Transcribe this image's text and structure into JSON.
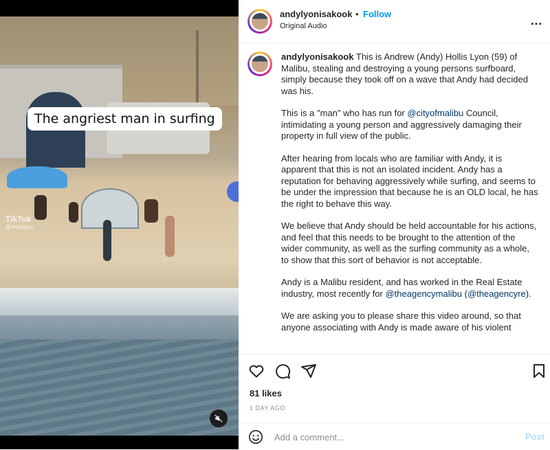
{
  "video": {
    "caption_overlay": "The angriest man in surfing",
    "watermark": "TikTok",
    "watermark_handle": "@andylyon"
  },
  "header": {
    "username": "andylyonisakook",
    "separator": "•",
    "follow_label": "Follow",
    "audio": "Original Audio",
    "more_icon": "…"
  },
  "post": {
    "username": "andylyonisakook",
    "paragraphs": [
      "This is Andrew (Andy) Hollis Lyon (59) of Malibu, stealing and destroying a young persons surfboard, simply because they took off on a wave that Andy had decided was his.",
      "This is a \"man\" who has run for ",
      "After hearing from locals who are familiar with Andy, it is apparent that this is not an isolated incident. Andy has a reputation for behaving aggressively while surfing, and seems to be under the impression that because he is an OLD local, he has the right to behave this way.",
      "We believe that Andy should be held accountable for his actions, and feel that this needs to be brought to the attention of the wider community, as well as the surfing community as a whole, to show that this sort of behavior is not acceptable.",
      "Andy is a Malibu resident, and has worked in the Real Estate industry, most recently for ",
      "We are asking you to please share this video around, so that anyone associating with Andy is made aware of his violent"
    ],
    "p2_mention": "@cityofmalibu",
    "p2_rest": " Council, intimidating a young person and aggressively damaging their property in full view of the public.",
    "p5_mention1": "@theagencymalibu",
    "p5_open": "(",
    "p5_mention2": "@theagencyre",
    "p5_close": ")."
  },
  "actions": {
    "likes": "81 likes",
    "timestamp": "1 DAY AGO"
  },
  "comment": {
    "placeholder": "Add a comment...",
    "post_label": "Post"
  }
}
